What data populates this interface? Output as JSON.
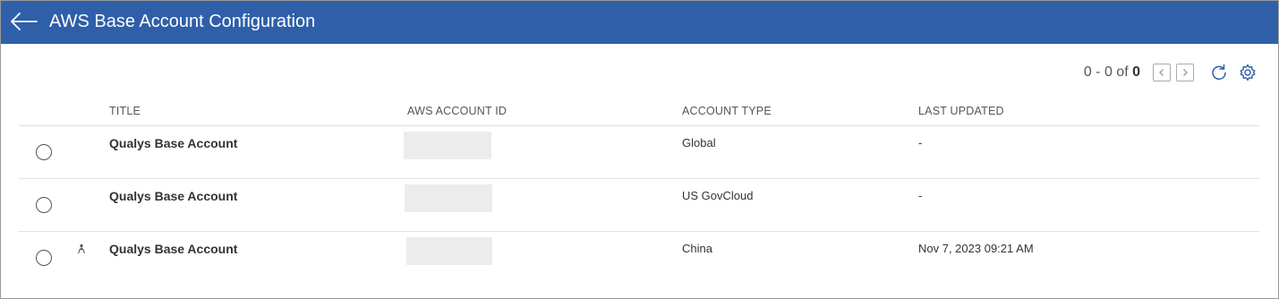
{
  "header": {
    "title": "AWS Base Account Configuration",
    "back_icon": "arrow-left-icon"
  },
  "pagination": {
    "range": "0 - 0 of",
    "total": "0"
  },
  "table": {
    "columns": [
      "TITLE",
      "AWS ACCOUNT ID",
      "ACCOUNT TYPE",
      "LAST UPDATED"
    ],
    "rows": [
      {
        "title": "Qualys Base Account",
        "account_type": "Global",
        "last_updated": "-"
      },
      {
        "title": "Qualys Base Account",
        "account_type": "US GovCloud",
        "last_updated": "-"
      },
      {
        "title": "Qualys Base Account",
        "account_type": "China",
        "last_updated": "Nov 7, 2023 09:21 AM"
      }
    ]
  },
  "colors": {
    "header_bg": "#2f5fa9",
    "icon_blue": "#2f5fa9"
  }
}
